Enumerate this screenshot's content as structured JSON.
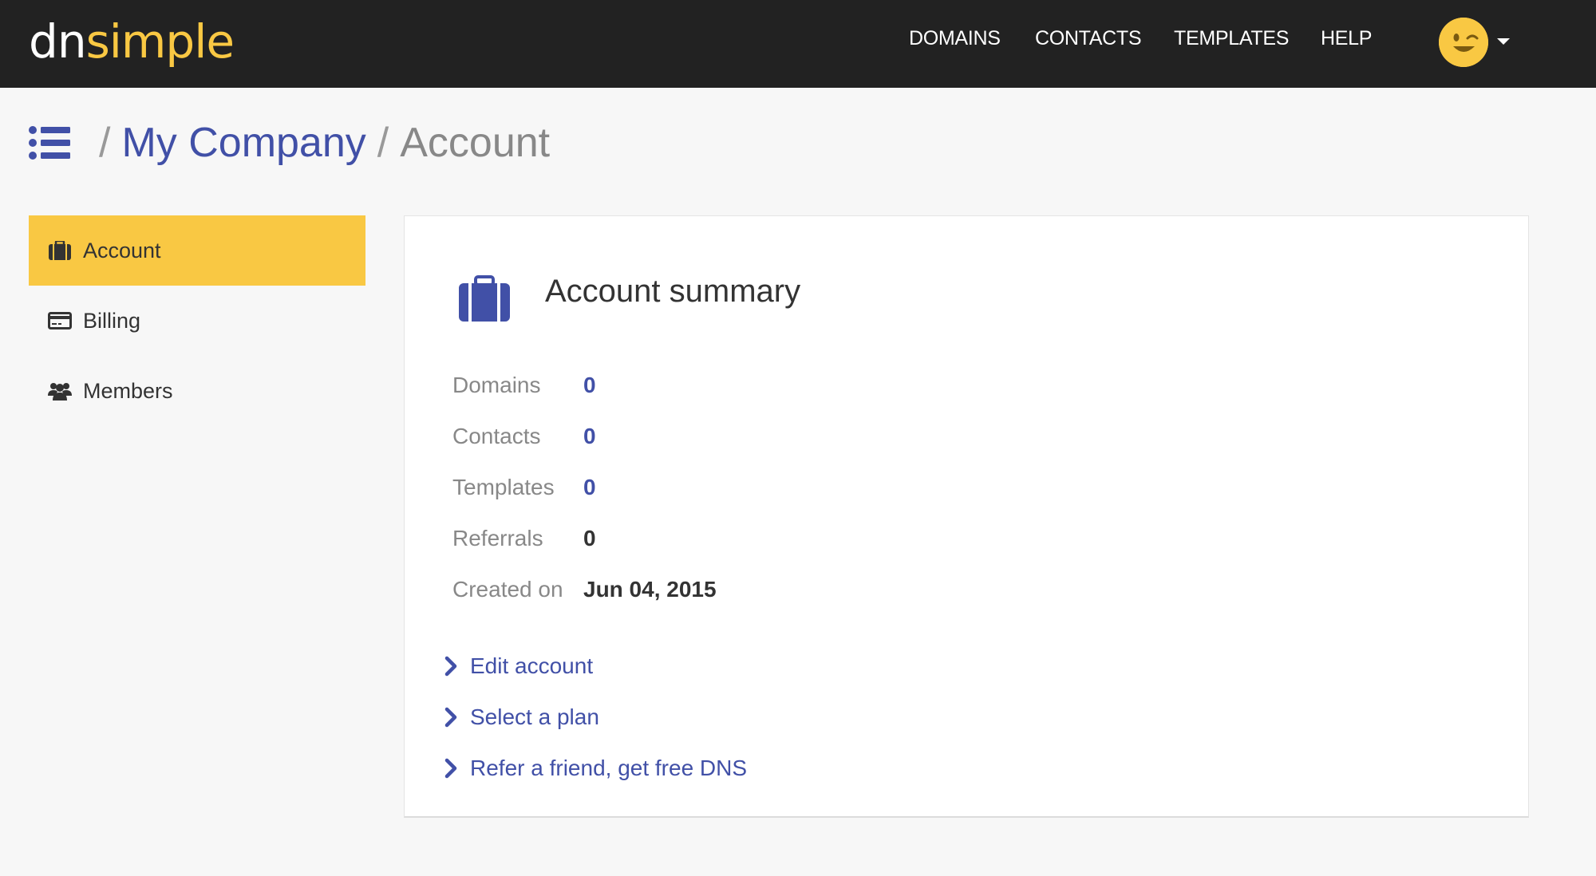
{
  "brand": {
    "logo_left": "dn",
    "logo_right": "simple"
  },
  "nav": {
    "domains": "DOMAINS",
    "contacts": "CONTACTS",
    "templates": "TEMPLATES",
    "help": "HELP"
  },
  "breadcrumb": {
    "sep1": "/",
    "company": "My Company",
    "sep2": "/",
    "current": "Account"
  },
  "sidebar": {
    "items": [
      {
        "label": "Account",
        "icon": "briefcase-icon",
        "active": true
      },
      {
        "label": "Billing",
        "icon": "credit-card-icon",
        "active": false
      },
      {
        "label": "Members",
        "icon": "users-icon",
        "active": false
      }
    ]
  },
  "summary": {
    "title": "Account summary",
    "stats": [
      {
        "label": "Domains",
        "value": "0"
      },
      {
        "label": "Contacts",
        "value": "0"
      },
      {
        "label": "Templates",
        "value": "0"
      },
      {
        "label": "Referrals",
        "value": "0"
      },
      {
        "label": "Created on",
        "value": "Jun 04, 2015"
      }
    ],
    "actions": [
      {
        "label": "Edit account"
      },
      {
        "label": "Select a plan"
      },
      {
        "label": "Refer a friend, get free DNS"
      }
    ]
  },
  "colors": {
    "accent": "#4150a7",
    "brand_yellow": "#f9c843",
    "topbar": "#222222"
  }
}
